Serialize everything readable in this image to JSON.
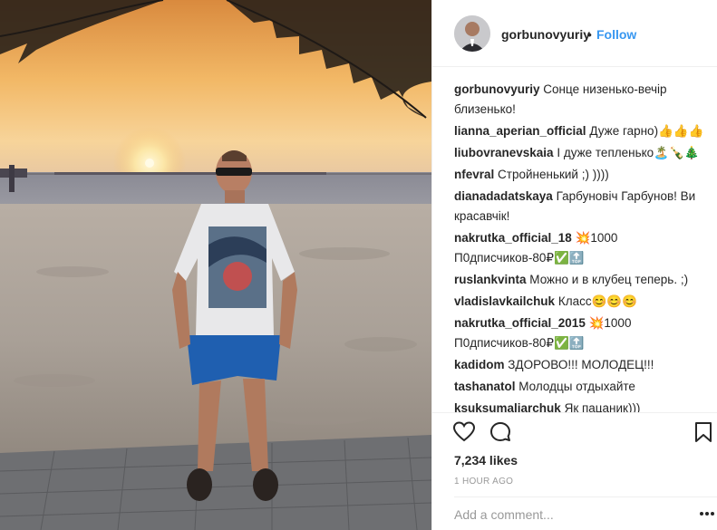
{
  "post": {
    "photo_description_icon": "photo-icon"
  },
  "header": {
    "username": "gorbunovyuriy",
    "separator": "•",
    "follow_label": "Follow"
  },
  "comments": [
    {
      "user": "gorbunovyuriy",
      "text": "Сонце низенько-вечір близенько!"
    },
    {
      "user": "lianna_aperian_official",
      "text": "Дуже гарно)👍👍👍"
    },
    {
      "user": "liubovranevskaia",
      "text": "I дуже тепленько🏝️🍾🎄"
    },
    {
      "user": "nfevral",
      "text": "Стройненький ;) ))))"
    },
    {
      "user": "dianadadatskaya",
      "text": "Гарбуновіч Гарбунов! Ви красавчік!"
    },
    {
      "user": "nakrutka_official_18",
      "text": "💥1000 П0дписчиков-80₽✅🔝"
    },
    {
      "user": "ruslankvinta",
      "text": "Можно и в клубец теперь. ;)"
    },
    {
      "user": "vladislavkailchuk",
      "text": "Класс😊😊😊"
    },
    {
      "user": "nakrutka_official_2015",
      "text": "💥1000 П0дписчиков-80₽✅🔝"
    },
    {
      "user": "kadidom",
      "text": "ЗДОРОВО!!! МОЛОДЕЦ!!!"
    },
    {
      "user": "tashanatol",
      "text": "Молодцы отдыхайте"
    },
    {
      "user": "ksuksumaliarchuk",
      "text": "Як пацаник)))"
    }
  ],
  "actions": {
    "like_icon": "heart-icon",
    "comment_icon": "comment-icon",
    "save_icon": "bookmark-icon"
  },
  "likes": "7,234 likes",
  "time": "1 HOUR AGO",
  "comment_input": {
    "placeholder": "Add a comment...",
    "value": ""
  },
  "colors": {
    "accent": "#3897f0",
    "text": "#262626",
    "muted": "#999999"
  }
}
